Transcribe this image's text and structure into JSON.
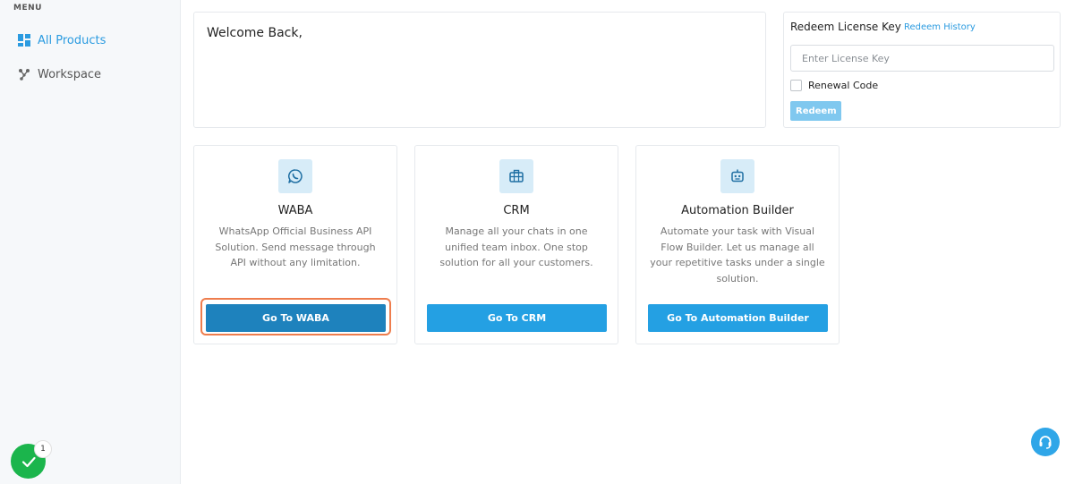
{
  "sidebar": {
    "menu_label": "MENU",
    "items": [
      {
        "label": "All Products",
        "icon": "grid-icon",
        "active": true
      },
      {
        "label": "Workspace",
        "icon": "network-icon",
        "active": false
      }
    ]
  },
  "welcome": {
    "text": "Welcome Back,"
  },
  "redeem": {
    "title": "Redeem License Key",
    "history_link": "Redeem History",
    "input_placeholder": "Enter License Key",
    "input_value": "",
    "renewal_label": "Renewal Code",
    "renewal_checked": false,
    "button_label": "Redeem"
  },
  "products": [
    {
      "title": "WABA",
      "icon": "whatsapp-icon",
      "description": "WhatsApp Official Business API Solution. Send message through API without any limitation.",
      "button_label": "Go To WABA"
    },
    {
      "title": "CRM",
      "icon": "briefcase-icon",
      "description": "Manage all your chats in one unified team inbox. One stop solution for all your customers.",
      "button_label": "Go To CRM"
    },
    {
      "title": "Automation Builder",
      "icon": "robot-icon",
      "description": "Automate your task with Visual Flow Builder. Let us manage all your repetitive tasks under a single solution.",
      "button_label": "Go To Automation Builder"
    }
  ],
  "status_badge": {
    "count": "1",
    "icon": "check-icon"
  },
  "support": {
    "icon": "headset-icon"
  },
  "colors": {
    "accent": "#24a0e3",
    "accent_dark": "#1e82bd",
    "success": "#1bb54c",
    "focus": "#ee7d4d"
  }
}
